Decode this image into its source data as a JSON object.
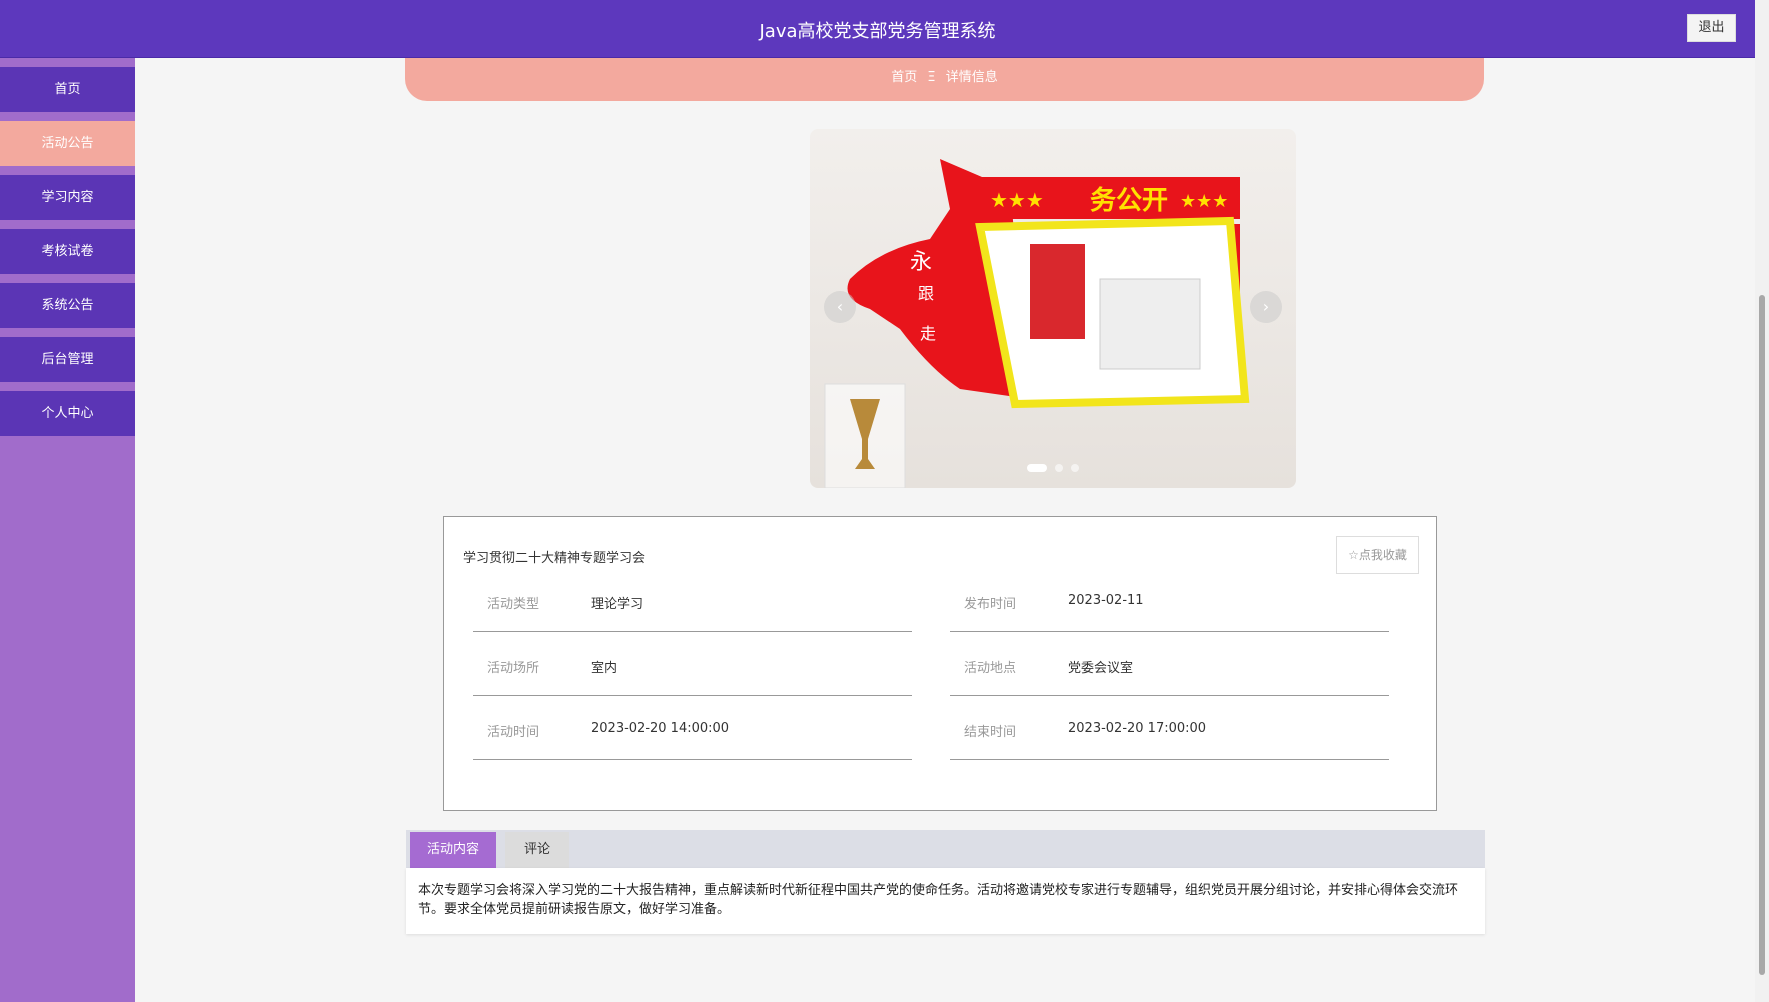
{
  "header": {
    "title": "Java高校党支部党务管理系统",
    "logout": "退出"
  },
  "sidebar": {
    "items": [
      {
        "label": "首页"
      },
      {
        "label": "活动公告"
      },
      {
        "label": "学习内容"
      },
      {
        "label": "考核试卷"
      },
      {
        "label": "系统公告"
      },
      {
        "label": "后台管理"
      },
      {
        "label": "个人中心"
      }
    ],
    "active": 1
  },
  "breadcrumb": {
    "home": "首页",
    "sep": "Ξ",
    "current": "详情信息"
  },
  "carousel": {
    "prev": "‹",
    "next": "›",
    "slides": 3,
    "active": 0
  },
  "detail": {
    "title": "学习贯彻二十大精神专题学习会",
    "favorite": "☆点我收藏",
    "fields": [
      {
        "label": "活动类型",
        "value": "理论学习"
      },
      {
        "label": "发布时间",
        "value": "2023-02-11"
      },
      {
        "label": "活动场所",
        "value": "室内"
      },
      {
        "label": "活动地点",
        "value": "党委会议室"
      },
      {
        "label": "活动时间",
        "value": "2023-02-20 14:00:00"
      },
      {
        "label": "结束时间",
        "value": "2023-02-20 17:00:00"
      }
    ]
  },
  "tabs": {
    "items": [
      {
        "label": "活动内容"
      },
      {
        "label": "评论"
      }
    ]
  },
  "content": "本次专题学习会将深入学习党的二十大报告精神，重点解读新时代新征程中国共产党的使命任务。活动将邀请党校专家进行专题辅导，组织党员开展分组讨论，并安排心得体会交流环节。要求全体党员提前研读报告原文，做好学习准备。"
}
